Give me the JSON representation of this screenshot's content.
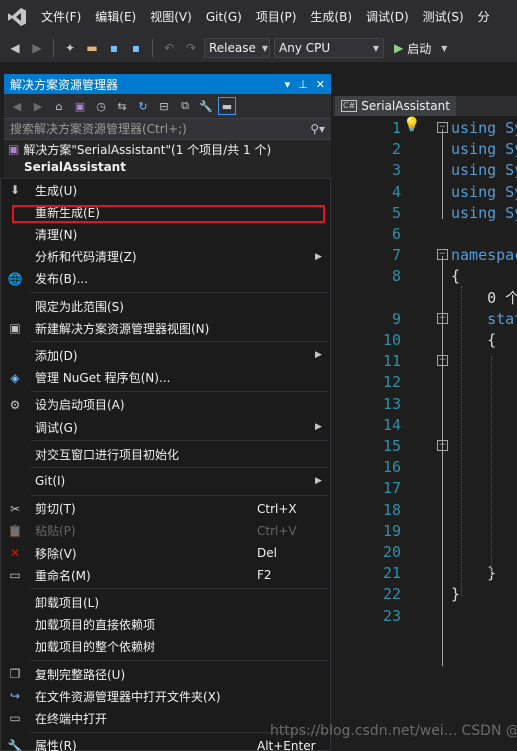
{
  "menubar": {
    "items": [
      "文件(F)",
      "编辑(E)",
      "视图(V)",
      "Git(G)",
      "项目(P)",
      "生成(B)",
      "调试(D)",
      "测试(S)",
      "分"
    ]
  },
  "toolbar": {
    "configuration": "Release",
    "platform": "Any CPU",
    "start_label": "启动"
  },
  "solution_explorer": {
    "title": "解决方案资源管理器",
    "title_buttons": [
      "▾",
      "📌",
      "✕"
    ],
    "search_placeholder": "搜索解决方案资源管理器(Ctrl+;)",
    "solution_row": "解决方案\"SerialAssistant\"(1 个项目/共 1 个)",
    "project_row": "SerialAssistant"
  },
  "editor": {
    "tab_label": "SerialAssistant",
    "lines": [
      {
        "n": "1",
        "code": "using Sy",
        "kw": true
      },
      {
        "n": "2",
        "code": "using Sy",
        "kw": true
      },
      {
        "n": "3",
        "code": "using Sy",
        "kw": true
      },
      {
        "n": "4",
        "code": "using Sy",
        "kw": true
      },
      {
        "n": "5",
        "code": "using Sy",
        "kw": true
      },
      {
        "n": "6",
        "code": ""
      },
      {
        "n": "7",
        "code": "namespac",
        "kw": true
      },
      {
        "n": "8",
        "code": "{"
      },
      {
        "n": "",
        "code": "    0 个"
      },
      {
        "n": "9",
        "code": "    stat",
        "kw": true
      },
      {
        "n": "10",
        "code": "    {"
      },
      {
        "n": "11",
        "code": ""
      },
      {
        "n": "12",
        "code": ""
      },
      {
        "n": "13",
        "code": ""
      },
      {
        "n": "14",
        "code": ""
      },
      {
        "n": "15",
        "code": ""
      },
      {
        "n": "16",
        "code": ""
      },
      {
        "n": "17",
        "code": ""
      },
      {
        "n": "18",
        "code": ""
      },
      {
        "n": "19",
        "code": ""
      },
      {
        "n": "20",
        "code": ""
      },
      {
        "n": "21",
        "code": "    }"
      },
      {
        "n": "22",
        "code": "}"
      },
      {
        "n": "23",
        "code": ""
      }
    ]
  },
  "context_menu": {
    "items": [
      {
        "label": "生成(U)",
        "icon": "build-icon",
        "glyph": "⬇"
      },
      {
        "label": "重新生成(E)",
        "highlighted": true
      },
      {
        "label": "清理(N)"
      },
      {
        "label": "分析和代码清理(Z)",
        "submenu": true
      },
      {
        "label": "发布(B)...",
        "icon": "globe-icon",
        "glyph": "🌐"
      },
      {
        "separator": true
      },
      {
        "label": "限定为此范围(S)"
      },
      {
        "label": "新建解决方案资源管理器视图(N)",
        "icon": "new-view-icon",
        "glyph": "▣"
      },
      {
        "separator": true
      },
      {
        "label": "添加(D)",
        "submenu": true
      },
      {
        "label": "管理 NuGet 程序包(N)...",
        "icon": "nuget-icon",
        "glyph": "◈"
      },
      {
        "separator": true
      },
      {
        "label": "设为启动项目(A)",
        "icon": "gear-icon",
        "glyph": "⚙"
      },
      {
        "label": "调试(G)",
        "submenu": true
      },
      {
        "separator": true
      },
      {
        "label": "对交互窗口进行项目初始化"
      },
      {
        "separator": true
      },
      {
        "label": "Git(I)",
        "submenu": true
      },
      {
        "separator": true
      },
      {
        "label": "剪切(T)",
        "shortcut": "Ctrl+X",
        "icon": "cut-icon",
        "glyph": "✂"
      },
      {
        "label": "粘贴(P)",
        "shortcut": "Ctrl+V",
        "disabled": true,
        "icon": "paste-icon",
        "glyph": "📋"
      },
      {
        "label": "移除(V)",
        "shortcut": "Del",
        "icon": "remove-icon",
        "glyph": "✕"
      },
      {
        "label": "重命名(M)",
        "shortcut": "F2",
        "icon": "rename-icon",
        "glyph": "▭"
      },
      {
        "separator": true
      },
      {
        "label": "卸载项目(L)"
      },
      {
        "label": "加载项目的直接依赖项"
      },
      {
        "label": "加载项目的整个依赖树"
      },
      {
        "separator": true
      },
      {
        "label": "复制完整路径(U)",
        "icon": "copy-icon",
        "glyph": "❐"
      },
      {
        "label": "在文件资源管理器中打开文件夹(X)",
        "icon": "open-folder-icon",
        "glyph": "↪"
      },
      {
        "label": "在终端中打开",
        "icon": "terminal-icon",
        "glyph": "▭"
      },
      {
        "separator": true
      },
      {
        "label": "属性(R)",
        "shortcut": "Alt+Enter",
        "icon": "wrench-icon",
        "glyph": "🔧"
      }
    ]
  },
  "watermark": "https://blog.csdn.net/wei... CSDN @黄昏和星空",
  "colors": {
    "accent": "#007acc",
    "highlight_border": "#e81123",
    "keyword": "#569cd6",
    "line_number": "#2b91af"
  }
}
